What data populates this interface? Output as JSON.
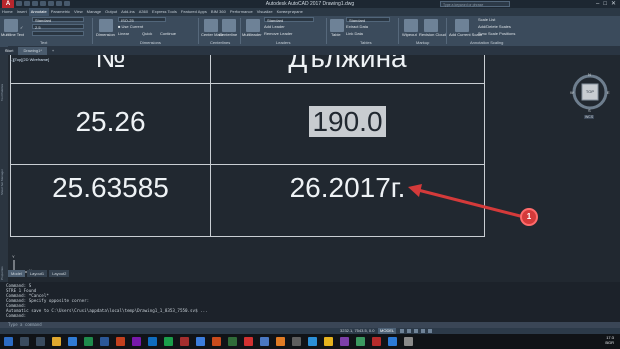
{
  "titlebar": {
    "title": "Autodesk AutoCAD 2017   Drawing1.dwg",
    "search_placeholder": "Type a keyword or phrase"
  },
  "ribbon_tabs": [
    "Home",
    "Insert",
    "Annotate",
    "Parametric",
    "View",
    "Manage",
    "Output",
    "Add-ins",
    "A360",
    "Express Tools",
    "Featured Apps",
    "BIM 360",
    "Performance",
    "Visualize",
    "Конвертиране"
  ],
  "ribbon": {
    "text_panel": "Text",
    "multiline_text": "Multiline Text",
    "check_spelling": "Check Spelling",
    "text_style": "Standard",
    "text_height": "2.5",
    "dimensions_panel": "Dimensions",
    "dimension_btn": "Dimension",
    "dim_style": "ISO-25",
    "linear": "Linear",
    "quick": "Quick",
    "continue": "Continue",
    "centerlines_panel": "Centerlines",
    "center_mark": "Center Mark",
    "centerline": "Centerline",
    "leaders_panel": "Leaders",
    "multileader": "Multileader",
    "add_leader": "Add Leader",
    "remove_leader": "Remove Leader",
    "leader_style": "Standard",
    "tables_panel": "Tables",
    "table_btn": "Table",
    "table_style": "Standard",
    "extract_data": "Extract Data",
    "link_data": "Link Data",
    "markup_panel": "Markup",
    "wipeout": "Wipeout",
    "revision_cloud": "Revision Cloud",
    "annotation_scaling_panel": "Annotation Scaling",
    "add_current_scale": "Add Current Scale",
    "scale_list": "Scale List",
    "add_delete_scales": "Add/Delete Scales",
    "sync_scale": "Sync Scale Positions"
  },
  "file_tabs": {
    "start": "Start",
    "drawing": "Drawing1*"
  },
  "viewport": {
    "label": "[-][Top][2D Wireframe]",
    "table": {
      "header": [
        "№",
        "Дължина"
      ],
      "rows": [
        [
          "25.26",
          "190.0"
        ],
        [
          "25.63585",
          "26.2017г."
        ]
      ]
    },
    "viewcube": {
      "top": "TOP",
      "n": "N",
      "s": "S",
      "e": "E",
      "w": "W",
      "wcs": "WCS"
    },
    "callout_number": "1",
    "ucs_x": "X",
    "ucs_y": "Y"
  },
  "palettes": {
    "left_top": "Tool Palettes",
    "left_mid": "Sheet Set Manager",
    "left_bottom": "Properties"
  },
  "layout_tabs": [
    "Model",
    "Layout1",
    "Layout2"
  ],
  "command": {
    "lines": [
      "Command: S",
      "STRE 1 Found",
      "Command: *Cancel*",
      "Command: Specify opposite corner:",
      "Command:",
      "Automatic save to C:\\Users\\Crusi\\appdata\\local\\temp\\Drawing1_1_8353_7550.sv$ ...",
      "Command:"
    ],
    "placeholder": "Type a command"
  },
  "status": {
    "coords": "3232.1, 7543.5, 0.0",
    "model": "MODEL"
  },
  "clock": {
    "time": "17:3",
    "lang": "BGR"
  },
  "colors": {
    "canvas": "#212830",
    "callout": "#d43a3a",
    "highlight": "#c8ccd0"
  }
}
